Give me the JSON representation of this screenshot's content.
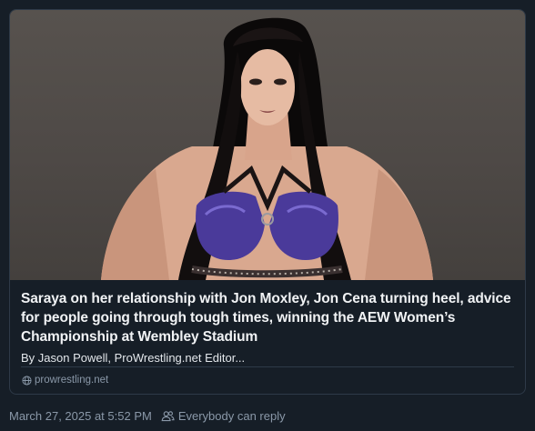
{
  "link_card": {
    "image_alt": "Saraya",
    "title": "Saraya on her relationship with Jon Moxley, Jon Cena turning heel, advice for people going through tough times, winning the AEW Women’s Championship at Wembley Stadium",
    "description": "By Jason Powell, ProWrestling.net Editor...",
    "domain": "prowrestling.net",
    "domain_icon": "globe-icon"
  },
  "post_meta": {
    "timestamp": "March 27, 2025 at 5:52 PM",
    "reply_setting": "Everybody can reply",
    "reply_icon": "people-icon"
  },
  "colors": {
    "background": "#161e27",
    "border": "#2e3a48",
    "text_primary": "#f1f3f5",
    "text_secondary": "#8a98a8"
  }
}
